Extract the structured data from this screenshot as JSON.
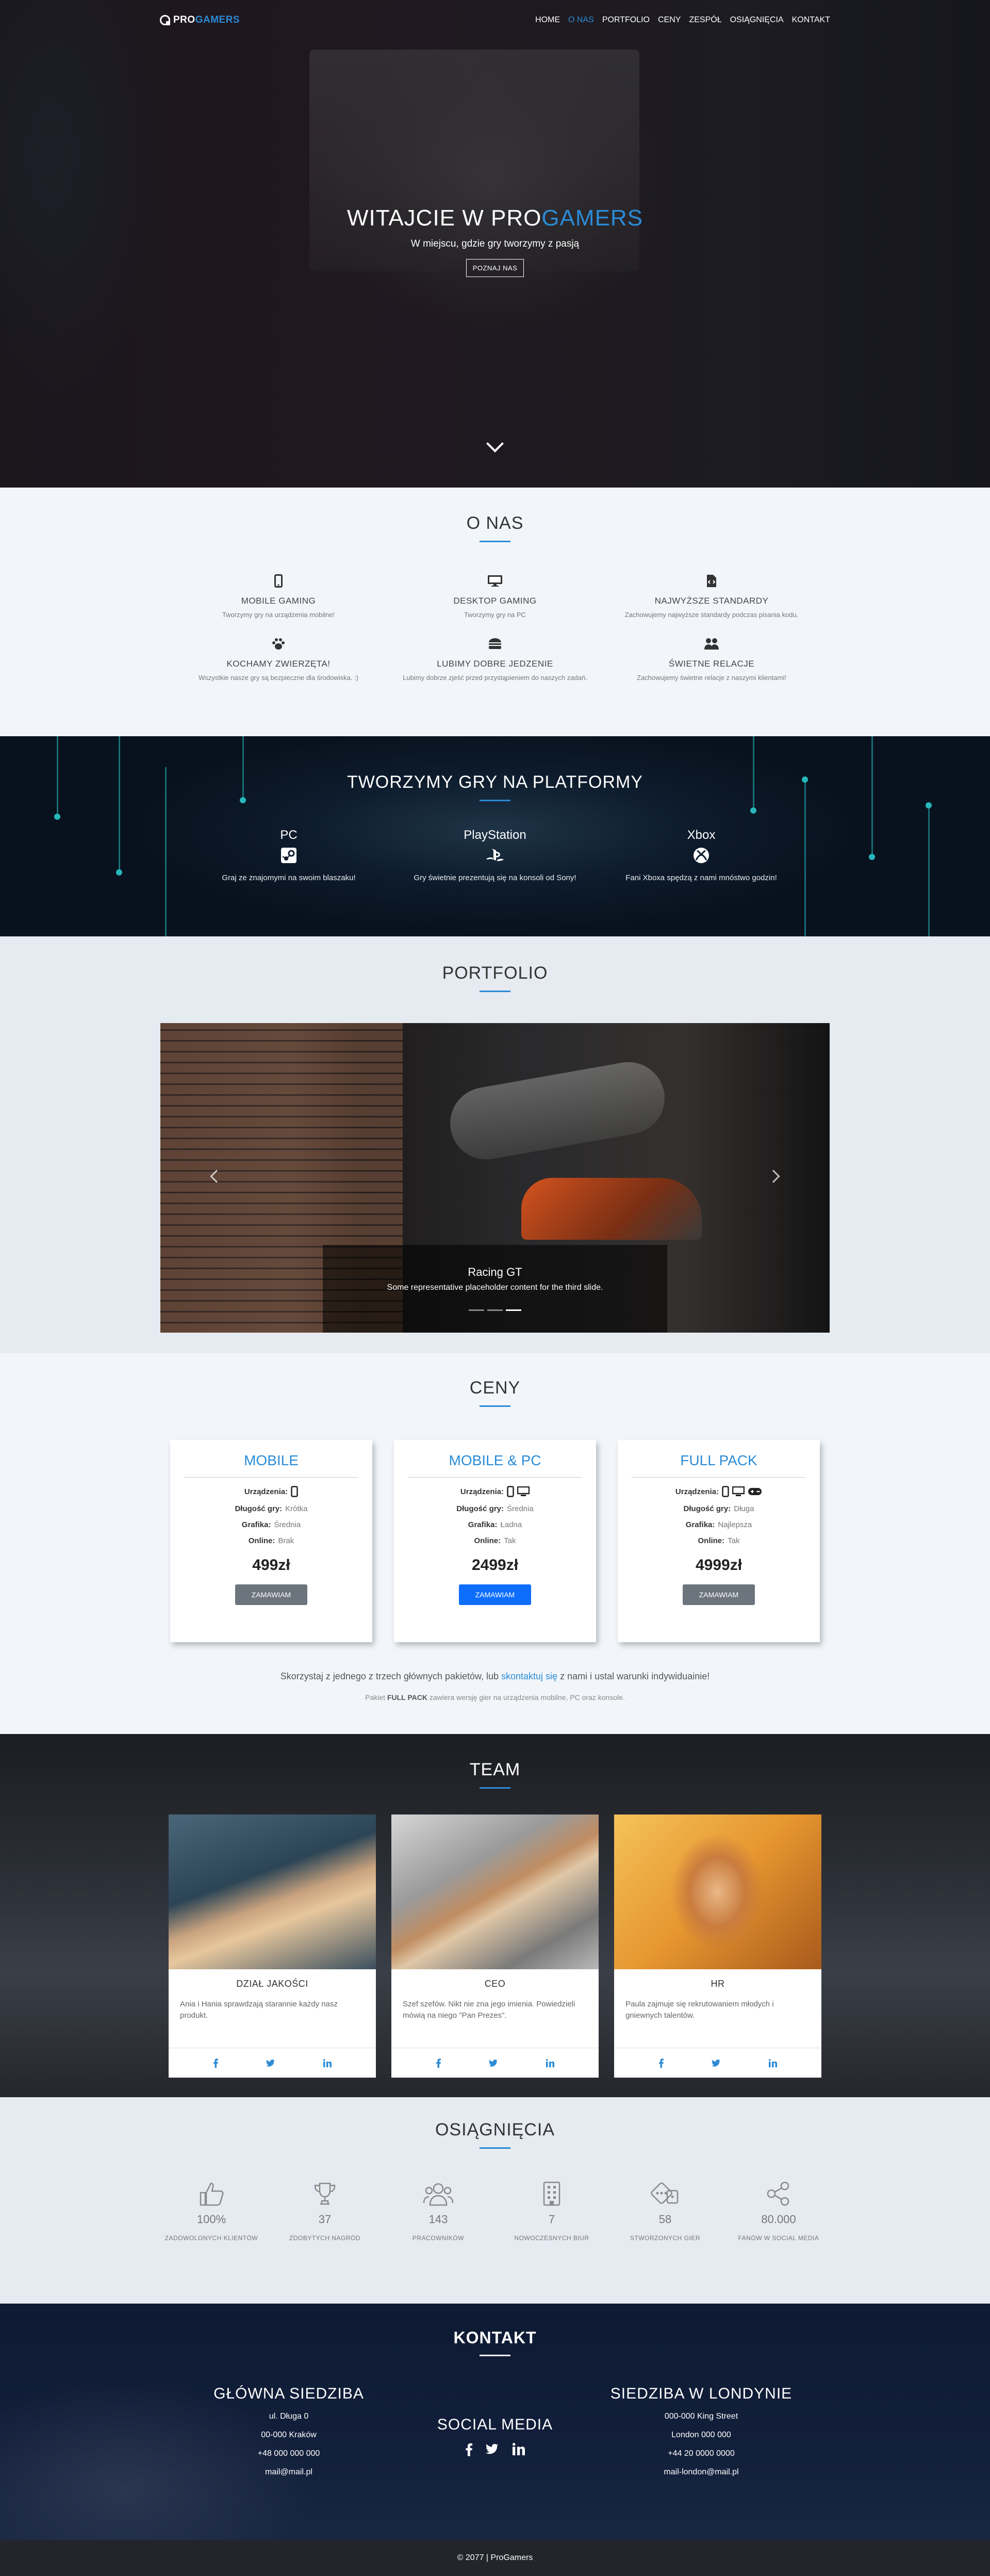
{
  "nav": {
    "logo_pro": "PRO",
    "logo_gamers": "GAMERS",
    "items": [
      "HOME",
      "O NAS",
      "PORTFOLIO",
      "CENY",
      "ZESPÓŁ",
      "OSIĄGNIĘCIA",
      "KONTAKT"
    ],
    "active_index": 1
  },
  "hero": {
    "title_main": "WITAJCIE W PRO",
    "title_accent": "GAMERS",
    "subtitle": "W miejscu, gdzie gry tworzymy z pasją",
    "button": "POZNAJ NAS",
    "scroll_icon": "chevron-down-icon"
  },
  "about": {
    "title": "O NAS",
    "features": [
      {
        "icon": "mobile-icon",
        "title": "MOBILE GAMING",
        "text": "Tworzymy gry na urządzenia mobilne!"
      },
      {
        "icon": "desktop-icon",
        "title": "DESKTOP GAMING",
        "text": "Tworzymy gry na PC"
      },
      {
        "icon": "file-code-icon",
        "title": "NAJWYŻSZE STANDARDY",
        "text": "Zachowujemy najwyższe standardy podczas pisania kodu."
      },
      {
        "icon": "paw-icon",
        "title": "KOCHAMY ZWIERZĘTA!",
        "text": "Wszystkie nasze gry są bezpieczne dla środowiska. :)"
      },
      {
        "icon": "hamburger-icon",
        "title": "LUBIMY DOBRE JEDZENIE",
        "text": "Lubimy dobrze zjeść przed przystąpieniem do naszych zadań."
      },
      {
        "icon": "people-icon",
        "title": "ŚWIETNE RELACJE",
        "text": "Zachowujemy świetne relacje z naszymi klientami!"
      }
    ]
  },
  "platforms": {
    "title": "TWORZYMY GRY NA PLATFORMY",
    "items": [
      {
        "name": "PC",
        "icon": "steam-icon",
        "text": "Graj ze znajomymi na swoim blaszaku!"
      },
      {
        "name": "PlayStation",
        "icon": "playstation-icon",
        "text": "Gry świetnie prezentują się na konsoli od Sony!"
      },
      {
        "name": "Xbox",
        "icon": "xbox-icon",
        "text": "Fani Xboxa spędzą z nami mnóstwo godzin!"
      }
    ]
  },
  "portfolio": {
    "title": "PORTFOLIO",
    "caption_title": "Racing GT",
    "caption_text": "Some representative placeholder content for the third slide.",
    "slide_count": 3,
    "active_slide": 2
  },
  "pricing": {
    "title": "CENY",
    "labels": {
      "device": "Urządzenia:",
      "length": "Długość gry:",
      "graphics": "Grafika:",
      "online": "Online:"
    },
    "plans": [
      {
        "name": "MOBILE",
        "devices": [
          "mobile-icon"
        ],
        "length": "Krótka",
        "graphics": "Średnia",
        "online": "Brak",
        "price": "499zł",
        "button": "ZAMAWIAM"
      },
      {
        "name": "MOBILE & PC",
        "devices": [
          "mobile-icon",
          "desktop-icon"
        ],
        "length": "Średnia",
        "graphics": "Ładna",
        "online": "Tak",
        "price": "2499zł",
        "button": "ZAMAWIAM"
      },
      {
        "name": "FULL PACK",
        "devices": [
          "mobile-icon",
          "desktop-icon",
          "gamepad-icon"
        ],
        "length": "Długa",
        "graphics": "Najlepsza",
        "online": "Tak",
        "price": "4999zł",
        "button": "ZAMAWIAM"
      }
    ],
    "highlight_index": 1,
    "note_before": "Skorzystaj z jednego z trzech głównych pakietów, lub ",
    "note_link": "skontaktuj się",
    "note_after": " z nami i ustal warunki indywiduainie!",
    "note2_before": "Pakiet ",
    "note2_bold": "FULL PACK",
    "note2_after": " zawiera wersję gier na urządzenia mobilne, PC oraz konsole."
  },
  "team": {
    "title": "TEAM",
    "members": [
      {
        "role": "DZIAŁ JAKOŚCI",
        "text": "Ania i Hania sprawdzają starannie każdy nasz produkt."
      },
      {
        "role": "CEO",
        "text": "Szef szefów. Nikt nie zna jego imienia. Powiedzieli mówią na niego \"Pan Prezes\"."
      },
      {
        "role": "HR",
        "text": "Paula zajmuje się rekrutowaniem młodych i gniewnych talentów."
      }
    ],
    "social_icons": [
      "facebook-icon",
      "twitter-icon",
      "linkedin-icon"
    ]
  },
  "achievements": {
    "title": "OSIĄGNIĘCIA",
    "items": [
      {
        "icon": "thumbs-up-icon",
        "value": "100%",
        "label": "ZADOWOLONYCH KLIENTÓW"
      },
      {
        "icon": "trophy-icon",
        "value": "37",
        "label": "ZDOBYTYCH NAGRÓD"
      },
      {
        "icon": "users-icon",
        "value": "143",
        "label": "PRACOWNIKÓW"
      },
      {
        "icon": "building-icon",
        "value": "7",
        "label": "NOWOCZESNYCH BIUR"
      },
      {
        "icon": "dice-icon",
        "value": "58",
        "label": "STWORZONYCH GIER"
      },
      {
        "icon": "share-icon",
        "value": "80.000",
        "label": "FANÓW W SOCIAL MEDIA"
      }
    ]
  },
  "contact": {
    "title": "KONTAKT",
    "hq": {
      "title": "GŁÓWNA SIEDZIBA",
      "lines": [
        "ul. Długa 0",
        "00-000 Kraków",
        "+48 000 000 000",
        "mail@mail.pl"
      ]
    },
    "social": {
      "title": "SOCIAL MEDIA",
      "icons": [
        "facebook-icon",
        "twitter-icon",
        "instagram-icon"
      ]
    },
    "london": {
      "title": "SIEDZIBA W LONDYNIE",
      "lines": [
        "000-000 King Street",
        "London 000 000",
        "+44 20 0000 0000",
        "mail-london@mail.pl"
      ]
    }
  },
  "footer": {
    "text": "© 2077 | ProGamers"
  },
  "colors": {
    "accent": "#2b8bd6",
    "primary_button": "#0d6efd",
    "secondary_button": "#6c757d"
  }
}
